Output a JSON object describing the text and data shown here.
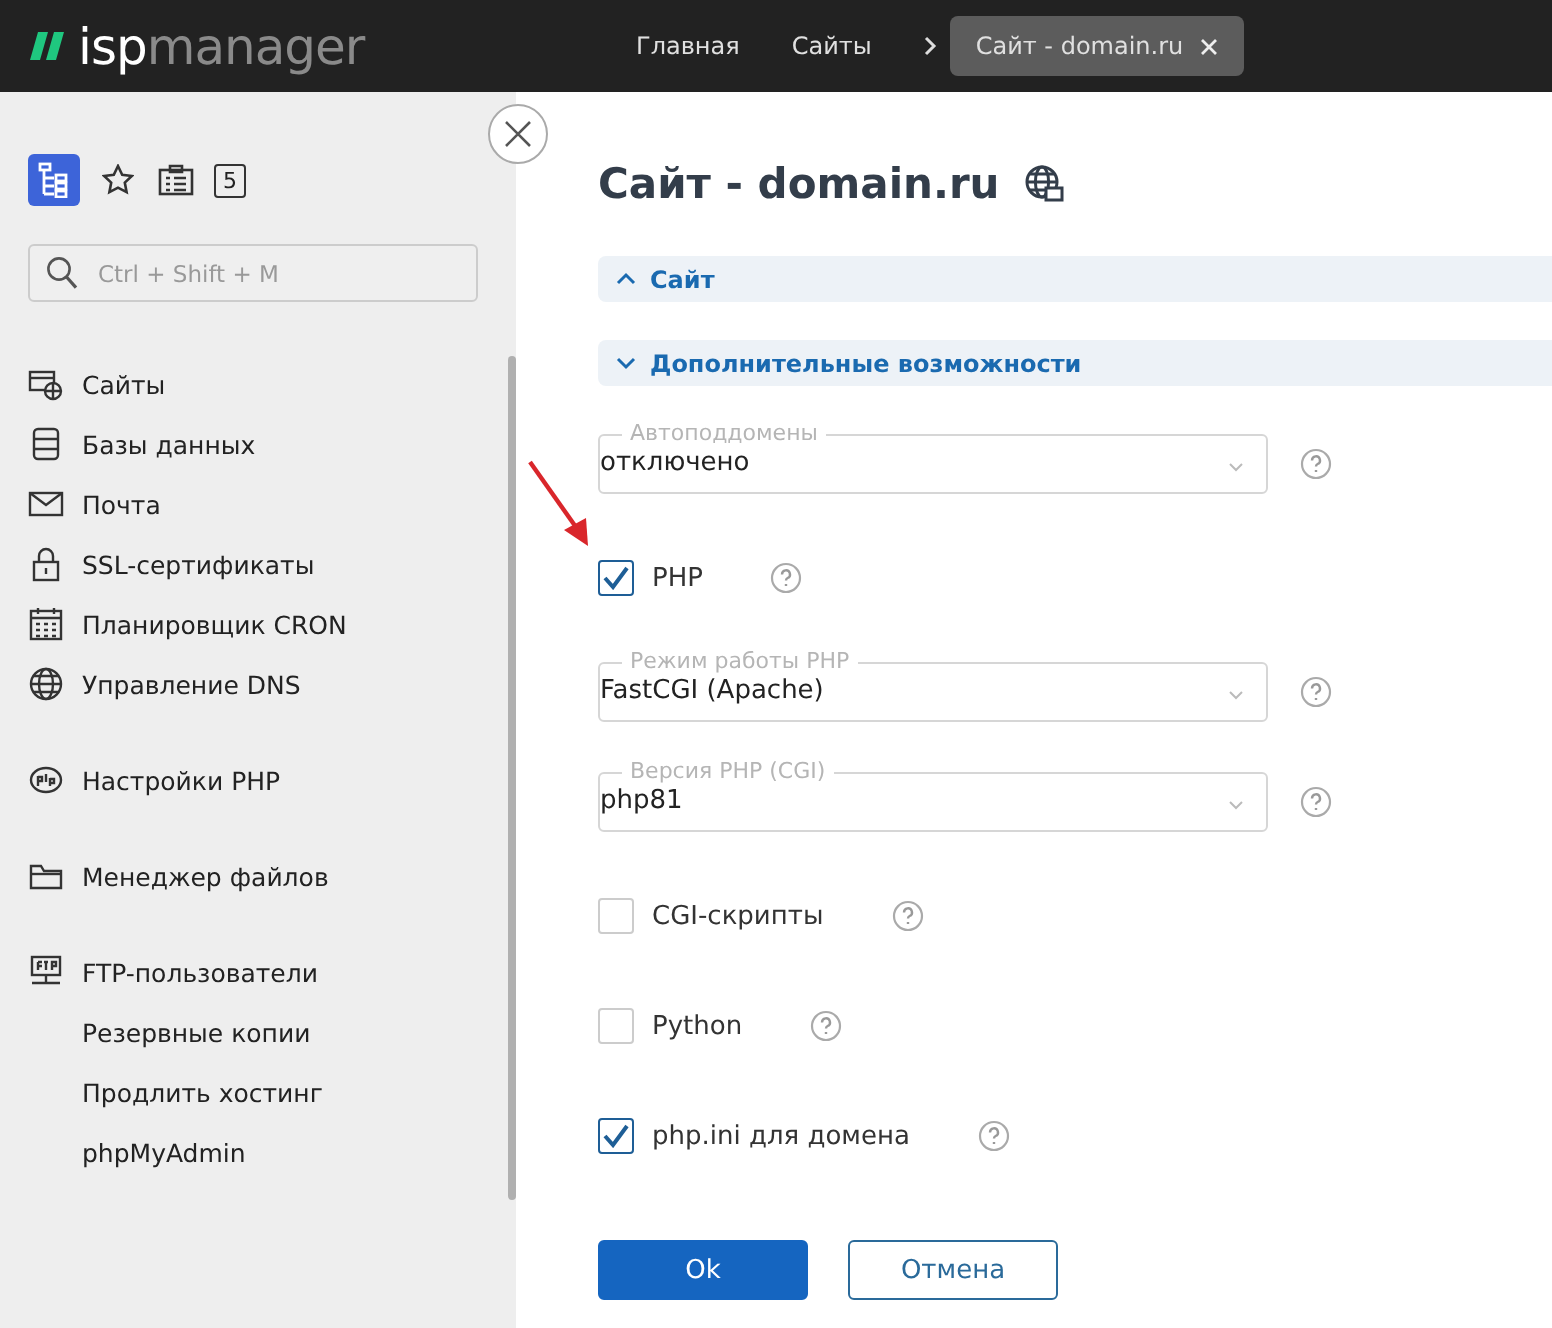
{
  "header": {
    "logo": {
      "strong": "isp",
      "rest": "manager"
    },
    "breadcrumbs": [
      {
        "label": "Главная",
        "selected": false
      },
      {
        "label": "Сайты",
        "selected": false
      },
      {
        "label": "Сайт - domain.ru",
        "selected": true
      }
    ]
  },
  "sidebar": {
    "toolbar": [
      {
        "kind": "tree",
        "selected": true
      },
      {
        "kind": "star",
        "selected": false
      },
      {
        "kind": "list",
        "selected": false
      },
      {
        "kind": "count",
        "label": "5",
        "selected": false
      }
    ],
    "search": {
      "placeholder": "Ctrl + Shift + M"
    },
    "groups": [
      [
        {
          "label": "Сайты"
        },
        {
          "label": "Базы данных"
        },
        {
          "label": "Почта"
        },
        {
          "label": "SSL-сертификаты"
        },
        {
          "label": "Планировщик CRON"
        },
        {
          "label": "Управление DNS"
        }
      ],
      [
        {
          "label": "Настройки PHP"
        }
      ],
      [
        {
          "label": "Менеджер файлов"
        }
      ],
      [
        {
          "label": "FTP-пользователи"
        },
        {
          "label": "Резервные копии"
        },
        {
          "label": "Продлить хостинг"
        },
        {
          "label": "phpMyAdmin"
        }
      ]
    ]
  },
  "page": {
    "title": "Сайт - domain.ru",
    "sections": [
      {
        "label": "Сайт",
        "expanded": false
      },
      {
        "label": "Дополнительные возможности",
        "expanded": true
      }
    ],
    "fields": [
      {
        "kind": "select",
        "label": "Автоподдомены",
        "value": "отключено"
      },
      {
        "kind": "checkbox",
        "label": "PHP",
        "checked": true
      },
      {
        "kind": "select",
        "label": "Режим работы PHP",
        "value": "FastCGI (Apache)"
      },
      {
        "kind": "select",
        "label": "Версия PHP (CGI)",
        "value": "php81"
      },
      {
        "kind": "checkbox",
        "label": "CGI-скрипты",
        "checked": false
      },
      {
        "kind": "checkbox",
        "label": "Python",
        "checked": false
      },
      {
        "kind": "checkbox",
        "label": "php.ini для домена",
        "checked": true
      }
    ],
    "buttons": [
      {
        "label": "Ok",
        "kind": "primary"
      },
      {
        "label": "Отмена",
        "kind": "secondary"
      }
    ]
  }
}
